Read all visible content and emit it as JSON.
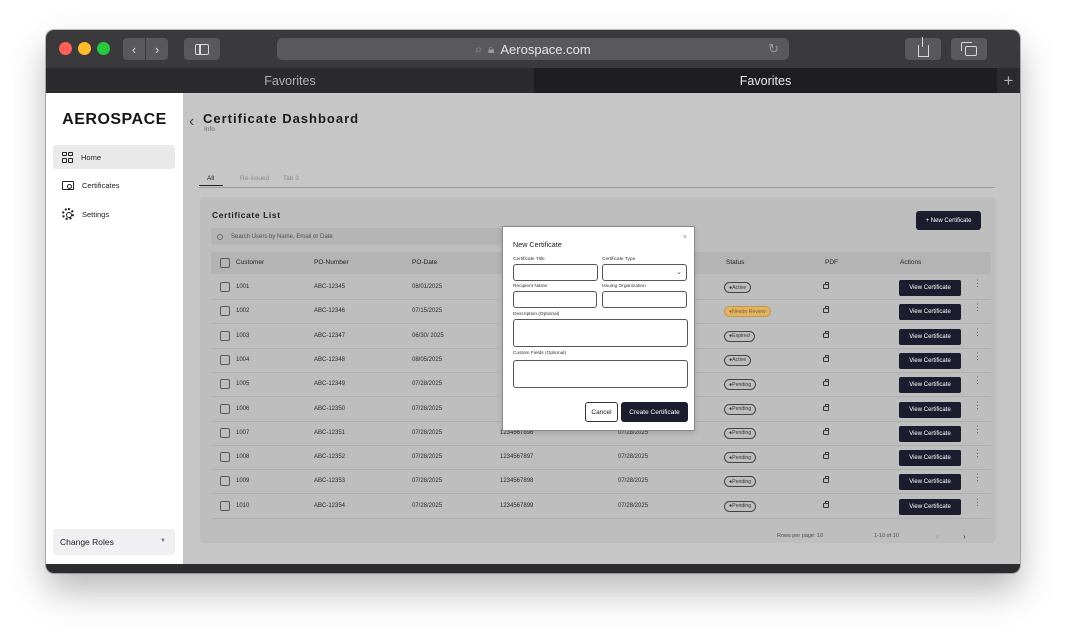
{
  "browser": {
    "url": "Aerospace.com",
    "tabs": [
      "Favorites",
      "Favorites"
    ],
    "add_tab": "+"
  },
  "sidebar": {
    "logo": "AEROSPACE",
    "items": [
      {
        "label": "Home",
        "icon": "grid-icon",
        "active": true
      },
      {
        "label": "Certificates",
        "icon": "certificate-icon"
      },
      {
        "label": "Settings",
        "icon": "gear-icon"
      }
    ],
    "change_roles": "Change Roles"
  },
  "header": {
    "title": "Certificate Dashboard",
    "subtitle": "Info"
  },
  "page_tabs": [
    "All",
    "Re-issued",
    "Tab 3"
  ],
  "list": {
    "title": "Certificate List",
    "search_placeholder": "Search Users by Name, Email or Date",
    "new_button": "+ New Certificate",
    "columns": [
      "Customer",
      "PO-Number",
      "PO-Date",
      "",
      "",
      "Status",
      "PDF",
      "Actions"
    ],
    "rows": [
      {
        "customer": "1001",
        "po": "ABC-12345",
        "date": "08/01/2025",
        "c4": "",
        "c5": "",
        "status": "Active",
        "review": false
      },
      {
        "customer": "1002",
        "po": "ABC-12346",
        "date": "07/15/2025",
        "c4": "",
        "c5": "",
        "status": "Needs Review",
        "review": true
      },
      {
        "customer": "1003",
        "po": "ABC-12347",
        "date": "06/30/ 2025",
        "c4": "",
        "c5": "",
        "status": "Expired",
        "review": false
      },
      {
        "customer": "1004",
        "po": "ABC-12348",
        "date": "08/05/2025",
        "c4": "",
        "c5": "",
        "status": "Active",
        "review": false
      },
      {
        "customer": "1005",
        "po": "ABC-12349",
        "date": "07/28/2025",
        "c4": "",
        "c5": "",
        "status": "Pending",
        "review": false
      },
      {
        "customer": "1006",
        "po": "ABC-12350",
        "date": "07/28/2025",
        "c4": "",
        "c5": "",
        "status": "Pending",
        "review": false
      },
      {
        "customer": "1007",
        "po": "ABC-12351",
        "date": "07/28/2025",
        "c4": "1234567896",
        "c5": "07/28/2025",
        "status": "Pending",
        "review": false
      },
      {
        "customer": "1008",
        "po": "ABC-12352",
        "date": "07/28/2025",
        "c4": "1234567897",
        "c5": "07/28/2025",
        "status": "Pending",
        "review": false
      },
      {
        "customer": "1009",
        "po": "ABC-12353",
        "date": "07/28/2025",
        "c4": "1234567898",
        "c5": "07/28/2025",
        "status": "Pending",
        "review": false
      },
      {
        "customer": "1010",
        "po": "ABC-12354",
        "date": "07/28/2025",
        "c4": "1234567899",
        "c5": "07/28/2025",
        "status": "Pending",
        "review": false
      }
    ],
    "view_label": "View Certificate",
    "rows_per_page": "Rows per page: 10",
    "range": "1-10 of 10"
  },
  "modal": {
    "title": "New Certificate",
    "close": "×",
    "fields": {
      "title_label": "Certificate Title",
      "type_label": "Certificate Type",
      "recipient_label": "Recipient Name",
      "org_label": "Issuing Organization",
      "description_label": "Description (Optional)",
      "custom_label": "Custom Fields (Optional)"
    },
    "cancel": "Cancel",
    "create": "Create Certificate"
  },
  "colors": {
    "primary_dark": "#1b1d2e",
    "review_badge": "#e0b466",
    "overlay": "#c6c6c6"
  }
}
